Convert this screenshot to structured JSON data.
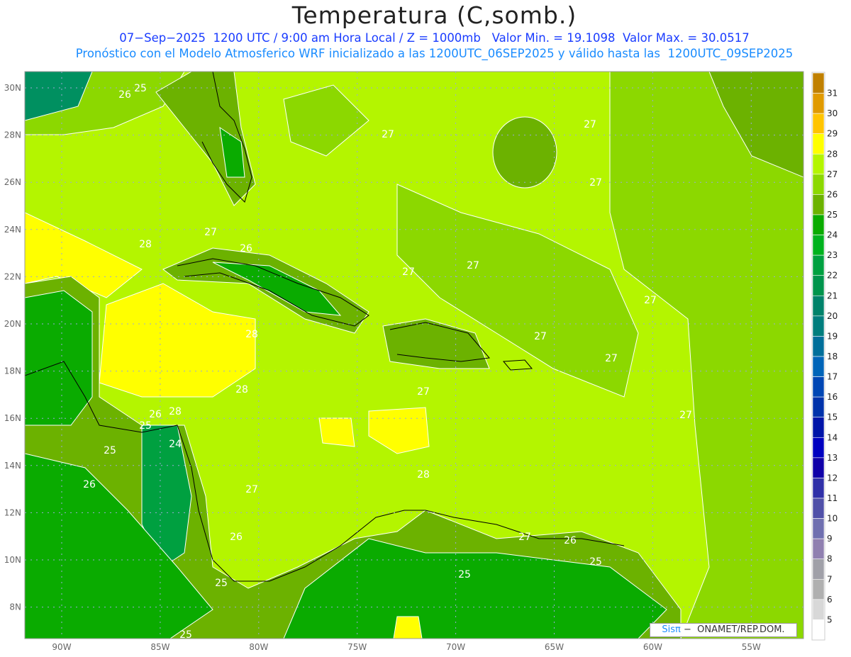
{
  "title": "Temperatura (C,somb.)",
  "subtitle": "07−Sep−2025  1200 UTC / 9:00 am Hora Local / Z = 1000mb   Valor Min. = 19.1098  Valor Max. = 30.0517",
  "info": "Pronóstico con el Modelo Atmosferico WRF inicializado a las 1200UTC_06SEP2025 y válido hasta las  1200UTC_09SEP2025",
  "lat_labels": [
    "30N",
    "28N",
    "26N",
    "24N",
    "22N",
    "20N",
    "18N",
    "16N",
    "14N",
    "12N",
    "10N",
    "8N"
  ],
  "lon_labels": [
    "90W",
    "85W",
    "80W",
    "75W",
    "70W",
    "65W",
    "60W",
    "55W"
  ],
  "colorbar": {
    "labels": [
      "31",
      "30",
      "29",
      "28",
      "27",
      "26",
      "25",
      "24",
      "23",
      "22",
      "21",
      "20",
      "19",
      "18",
      "17",
      "16",
      "15",
      "14",
      "13",
      "12",
      "11",
      "10",
      "9",
      "8",
      "7",
      "6",
      "5"
    ],
    "colors": [
      "#c08000",
      "#e09a00",
      "#ffc400",
      "#ffff00",
      "#b4f500",
      "#8cd800",
      "#6cb200",
      "#0aab00",
      "#00b21e",
      "#00a040",
      "#00944c",
      "#00826a",
      "#007d7d",
      "#006e9a",
      "#0064b8",
      "#0046b4",
      "#0032aa",
      "#0014a8",
      "#0000c0",
      "#1000a8",
      "#3030a8",
      "#5050a8",
      "#7070b0",
      "#9080b0",
      "#a0a0a8",
      "#b0b0b0",
      "#d8d8d8",
      "#ffffff"
    ]
  },
  "contour_labels": [
    "26",
    "25",
    "27",
    "27",
    "27",
    "27",
    "28",
    "26",
    "27",
    "27",
    "27",
    "28",
    "27",
    "27",
    "28",
    "27",
    "26",
    "28",
    "25",
    "27",
    "24",
    "25",
    "28",
    "26",
    "27",
    "26",
    "27",
    "26",
    "25",
    "25",
    "25",
    "25"
  ],
  "credit": {
    "brand": "Sisπ",
    "text": " −  ONAMET/REP.DOM."
  }
}
